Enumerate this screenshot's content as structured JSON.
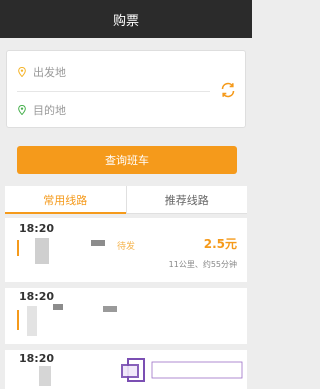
{
  "header": {
    "title": "购票"
  },
  "form": {
    "from_placeholder": "出发地",
    "to_placeholder": "目的地",
    "query_label": "查询班车"
  },
  "tabs": [
    {
      "label": "常用线路",
      "active": true
    },
    {
      "label": "推荐线路",
      "active": false
    }
  ],
  "routes": [
    {
      "time": "18:20",
      "tag": "待发",
      "price": "2.5元",
      "meta": "11公里、约55分钟"
    },
    {
      "time": "18:20"
    },
    {
      "time": "18:20"
    }
  ],
  "colors": {
    "accent": "#f59a1b",
    "header": "#2b2b2b",
    "from_pin": "#f5b42a",
    "to_pin": "#48b04e"
  },
  "icons": {
    "from": "location-pin-icon",
    "to": "location-pin-icon",
    "swap": "refresh-swap-icon"
  }
}
